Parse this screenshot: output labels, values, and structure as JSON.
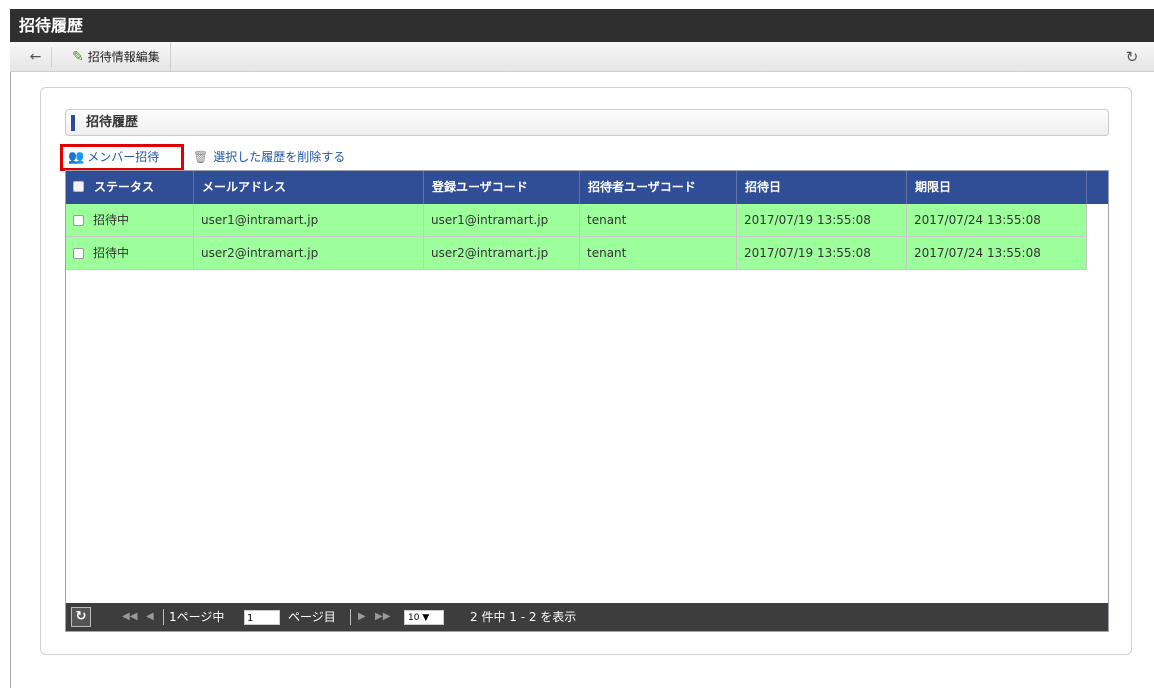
{
  "window": {
    "title": "招待履歴"
  },
  "toolbar": {
    "back_icon": "arrow-left-icon",
    "edit_label": "招待情報編集",
    "edit_icon": "pencil-icon",
    "refresh_icon": "refresh-icon"
  },
  "section": {
    "title": "招待履歴"
  },
  "actions": {
    "invite_label": "メンバー招待",
    "invite_icon": "user-add-icon",
    "delete_label": "選択した履歴を削除する",
    "delete_icon": "trash-icon"
  },
  "table": {
    "columns": [
      "ステータス",
      "メールアドレス",
      "登録ユーザコード",
      "招待者ユーザコード",
      "招待日",
      "期限日"
    ],
    "rows": [
      {
        "status": "招待中",
        "email": "user1@intramart.jp",
        "user_code": "user1@intramart.jp",
        "inviter": "tenant",
        "invited": "2017/07/19 13:55:08",
        "expires": "2017/07/24 13:55:08"
      },
      {
        "status": "招待中",
        "email": "user2@intramart.jp",
        "user_code": "user2@intramart.jp",
        "inviter": "tenant",
        "invited": "2017/07/19 13:55:08",
        "expires": "2017/07/24 13:55:08"
      }
    ],
    "row_color": "#9cff9c",
    "header_color": "#2f4e95"
  },
  "pager": {
    "current_page": "1",
    "page_of_prefix": "1ページ中",
    "page_suffix": "ページ目",
    "page_size": "10",
    "summary": "2 件中 1 - 2 を表示"
  },
  "colors": {
    "highlight_border": "#e00000",
    "link": "#1f56a6"
  }
}
